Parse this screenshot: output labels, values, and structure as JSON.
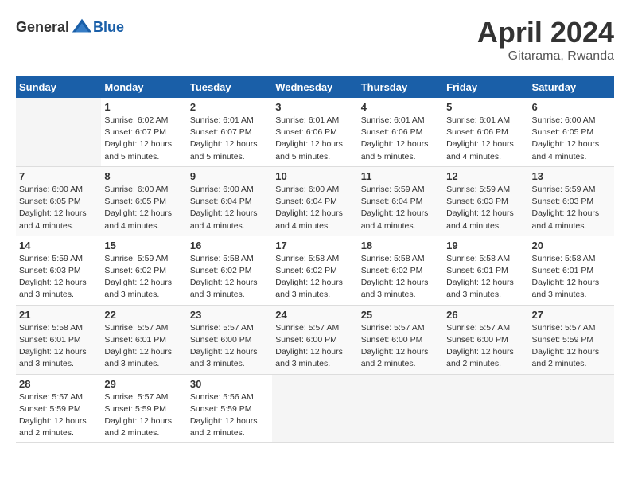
{
  "header": {
    "logo_general": "General",
    "logo_blue": "Blue",
    "month": "April 2024",
    "location": "Gitarama, Rwanda"
  },
  "weekdays": [
    "Sunday",
    "Monday",
    "Tuesday",
    "Wednesday",
    "Thursday",
    "Friday",
    "Saturday"
  ],
  "weeks": [
    [
      {
        "day": "",
        "details": ""
      },
      {
        "day": "1",
        "details": "Sunrise: 6:02 AM\nSunset: 6:07 PM\nDaylight: 12 hours\nand 5 minutes."
      },
      {
        "day": "2",
        "details": "Sunrise: 6:01 AM\nSunset: 6:07 PM\nDaylight: 12 hours\nand 5 minutes."
      },
      {
        "day": "3",
        "details": "Sunrise: 6:01 AM\nSunset: 6:06 PM\nDaylight: 12 hours\nand 5 minutes."
      },
      {
        "day": "4",
        "details": "Sunrise: 6:01 AM\nSunset: 6:06 PM\nDaylight: 12 hours\nand 5 minutes."
      },
      {
        "day": "5",
        "details": "Sunrise: 6:01 AM\nSunset: 6:06 PM\nDaylight: 12 hours\nand 4 minutes."
      },
      {
        "day": "6",
        "details": "Sunrise: 6:00 AM\nSunset: 6:05 PM\nDaylight: 12 hours\nand 4 minutes."
      }
    ],
    [
      {
        "day": "7",
        "details": "Sunrise: 6:00 AM\nSunset: 6:05 PM\nDaylight: 12 hours\nand 4 minutes."
      },
      {
        "day": "8",
        "details": "Sunrise: 6:00 AM\nSunset: 6:05 PM\nDaylight: 12 hours\nand 4 minutes."
      },
      {
        "day": "9",
        "details": "Sunrise: 6:00 AM\nSunset: 6:04 PM\nDaylight: 12 hours\nand 4 minutes."
      },
      {
        "day": "10",
        "details": "Sunrise: 6:00 AM\nSunset: 6:04 PM\nDaylight: 12 hours\nand 4 minutes."
      },
      {
        "day": "11",
        "details": "Sunrise: 5:59 AM\nSunset: 6:04 PM\nDaylight: 12 hours\nand 4 minutes."
      },
      {
        "day": "12",
        "details": "Sunrise: 5:59 AM\nSunset: 6:03 PM\nDaylight: 12 hours\nand 4 minutes."
      },
      {
        "day": "13",
        "details": "Sunrise: 5:59 AM\nSunset: 6:03 PM\nDaylight: 12 hours\nand 4 minutes."
      }
    ],
    [
      {
        "day": "14",
        "details": "Sunrise: 5:59 AM\nSunset: 6:03 PM\nDaylight: 12 hours\nand 3 minutes."
      },
      {
        "day": "15",
        "details": "Sunrise: 5:59 AM\nSunset: 6:02 PM\nDaylight: 12 hours\nand 3 minutes."
      },
      {
        "day": "16",
        "details": "Sunrise: 5:58 AM\nSunset: 6:02 PM\nDaylight: 12 hours\nand 3 minutes."
      },
      {
        "day": "17",
        "details": "Sunrise: 5:58 AM\nSunset: 6:02 PM\nDaylight: 12 hours\nand 3 minutes."
      },
      {
        "day": "18",
        "details": "Sunrise: 5:58 AM\nSunset: 6:02 PM\nDaylight: 12 hours\nand 3 minutes."
      },
      {
        "day": "19",
        "details": "Sunrise: 5:58 AM\nSunset: 6:01 PM\nDaylight: 12 hours\nand 3 minutes."
      },
      {
        "day": "20",
        "details": "Sunrise: 5:58 AM\nSunset: 6:01 PM\nDaylight: 12 hours\nand 3 minutes."
      }
    ],
    [
      {
        "day": "21",
        "details": "Sunrise: 5:58 AM\nSunset: 6:01 PM\nDaylight: 12 hours\nand 3 minutes."
      },
      {
        "day": "22",
        "details": "Sunrise: 5:57 AM\nSunset: 6:01 PM\nDaylight: 12 hours\nand 3 minutes."
      },
      {
        "day": "23",
        "details": "Sunrise: 5:57 AM\nSunset: 6:00 PM\nDaylight: 12 hours\nand 3 minutes."
      },
      {
        "day": "24",
        "details": "Sunrise: 5:57 AM\nSunset: 6:00 PM\nDaylight: 12 hours\nand 3 minutes."
      },
      {
        "day": "25",
        "details": "Sunrise: 5:57 AM\nSunset: 6:00 PM\nDaylight: 12 hours\nand 2 minutes."
      },
      {
        "day": "26",
        "details": "Sunrise: 5:57 AM\nSunset: 6:00 PM\nDaylight: 12 hours\nand 2 minutes."
      },
      {
        "day": "27",
        "details": "Sunrise: 5:57 AM\nSunset: 5:59 PM\nDaylight: 12 hours\nand 2 minutes."
      }
    ],
    [
      {
        "day": "28",
        "details": "Sunrise: 5:57 AM\nSunset: 5:59 PM\nDaylight: 12 hours\nand 2 minutes."
      },
      {
        "day": "29",
        "details": "Sunrise: 5:57 AM\nSunset: 5:59 PM\nDaylight: 12 hours\nand 2 minutes."
      },
      {
        "day": "30",
        "details": "Sunrise: 5:56 AM\nSunset: 5:59 PM\nDaylight: 12 hours\nand 2 minutes."
      },
      {
        "day": "",
        "details": ""
      },
      {
        "day": "",
        "details": ""
      },
      {
        "day": "",
        "details": ""
      },
      {
        "day": "",
        "details": ""
      }
    ]
  ]
}
